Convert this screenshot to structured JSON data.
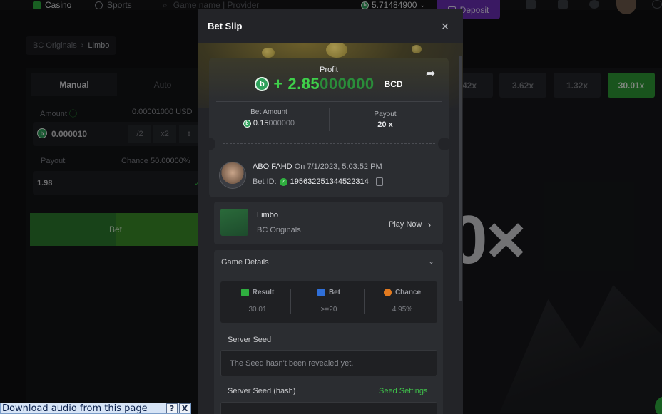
{
  "topbar": {
    "casino": "Casino",
    "sports": "Sports",
    "search_placeholder": "Game name | Provider",
    "balance": "5.71484900",
    "deposit": "Deposit"
  },
  "left": {
    "breadcrumb_root": "BC Originals",
    "breadcrumb_current": "Limbo",
    "tab_manual": "Manual",
    "tab_auto": "Auto",
    "amount_label": "Amount",
    "amount_usd": "0.00001000 USD",
    "amount_value": "0.000010",
    "half": "/2",
    "double": "x2",
    "payout_label": "Payout",
    "chance_label": "Chance",
    "chance_value": "50.00000%",
    "payout_value": "1.98",
    "bet_button": "Bet"
  },
  "history": [
    "42x",
    "3.62x",
    "1.32x",
    "30.01x"
  ],
  "big_multiplier": "0×",
  "modal": {
    "title": "Bet Slip",
    "close": "×",
    "profit_label": "Profit",
    "profit_bright": "+ 2.85",
    "profit_dim": "000000",
    "currency": "BCD",
    "bet_amount_label": "Bet Amount",
    "bet_amount_bright": "0.15",
    "bet_amount_dim": "000000",
    "payout_label": "Payout",
    "payout_value": "20 x",
    "user_name": "ABO FAHD",
    "user_date": "On 7/1/2023, 5:03:52 PM",
    "bet_id_label": "Bet ID:",
    "bet_id": "195632251344522314",
    "game_name": "Limbo",
    "game_provider": "BC Originals",
    "play_now": "Play Now",
    "game_details": "Game Details",
    "stat_result_label": "Result",
    "stat_result_value": "30.01",
    "stat_bet_label": "Bet",
    "stat_bet_value": ">=20",
    "stat_chance_label": "Chance",
    "stat_chance_value": "4.95%",
    "server_seed_label": "Server Seed",
    "server_seed_value": "The Seed hasn't been revealed yet.",
    "server_seed_hash_label": "Server Seed (hash)",
    "seed_settings": "Seed Settings"
  },
  "extension_bar": {
    "text": "Download audio from this page",
    "help": "?",
    "close": "X"
  },
  "colors": {
    "accent_green": "#3fcf4a",
    "deposit_purple": "#6a2fb5",
    "modal_bg": "#232428"
  }
}
